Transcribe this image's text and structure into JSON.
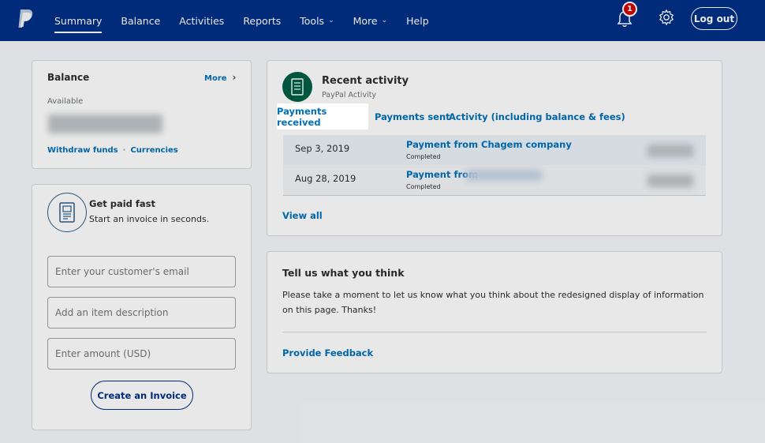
{
  "header": {
    "nav": [
      "Summary",
      "Balance",
      "Activities",
      "Reports",
      "Tools",
      "More",
      "Help"
    ],
    "notification_count": "1",
    "logout_label": "Log out",
    "brand_color": "#003087"
  },
  "balance": {
    "title": "Balance",
    "more_label": "More",
    "available_label": "Available",
    "withdraw_label": "Withdraw funds",
    "currencies_label": "Currencies"
  },
  "invoice": {
    "title": "Get paid fast",
    "subtitle": "Start an invoice in seconds.",
    "email_placeholder": "Enter your customer's email",
    "item_placeholder": "Add an item description",
    "amount_placeholder": "Enter amount (USD)",
    "create_label": "Create an Invoice"
  },
  "activity": {
    "title": "Recent activity",
    "subtitle": "PayPal Activity",
    "tabs": [
      "Payments received",
      "Payments sent",
      "Activity (including balance & fees)"
    ],
    "rows": [
      {
        "date": "Sep 3, 2019",
        "desc": "Payment from Chagem company",
        "status": "Completed"
      },
      {
        "date": "Aug 28, 2019",
        "desc": "Payment from",
        "status": "Completed"
      }
    ],
    "view_all": "View all"
  },
  "feedback": {
    "title": "Tell us what you think",
    "text": "Please take a moment to let us know what you think about the redesigned display of information on this page. Thanks!",
    "link": "Provide Feedback"
  }
}
